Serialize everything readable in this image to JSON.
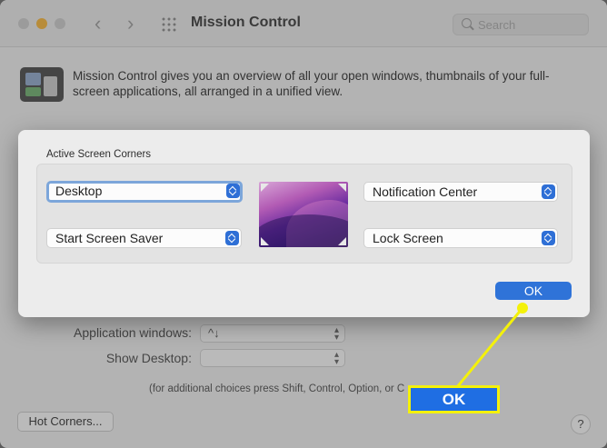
{
  "window": {
    "title": "Mission Control",
    "search_placeholder": "Search",
    "back_glyph": "‹",
    "forward_glyph": "›",
    "description": "Mission Control gives you an overview of all your open windows, thumbnails of your full-screen applications, all arranged in a unified view.",
    "app_windows_label": "Application windows:",
    "app_windows_value": "^↓",
    "show_desktop_label": "Show Desktop:",
    "show_desktop_value": "",
    "footnote": "(for additional choices press Shift, Control, Option, or C",
    "hot_corners_button": "Hot Corners...",
    "help_button": "?",
    "traffic_light_accent": "#f4b33a"
  },
  "sheet": {
    "title": "Active Screen Corners",
    "top_left": "Desktop",
    "bottom_left": "Start Screen Saver",
    "top_right": "Notification Center",
    "bottom_right": "Lock Screen",
    "ok_label": "OK"
  },
  "callout": {
    "label": "OK",
    "color": "#f4f10a",
    "box_color": "#1f6ee3"
  },
  "icons": [
    "grid-icon",
    "search-icon",
    "mission-control-app-icon",
    "stepper-icon",
    "help-icon"
  ]
}
